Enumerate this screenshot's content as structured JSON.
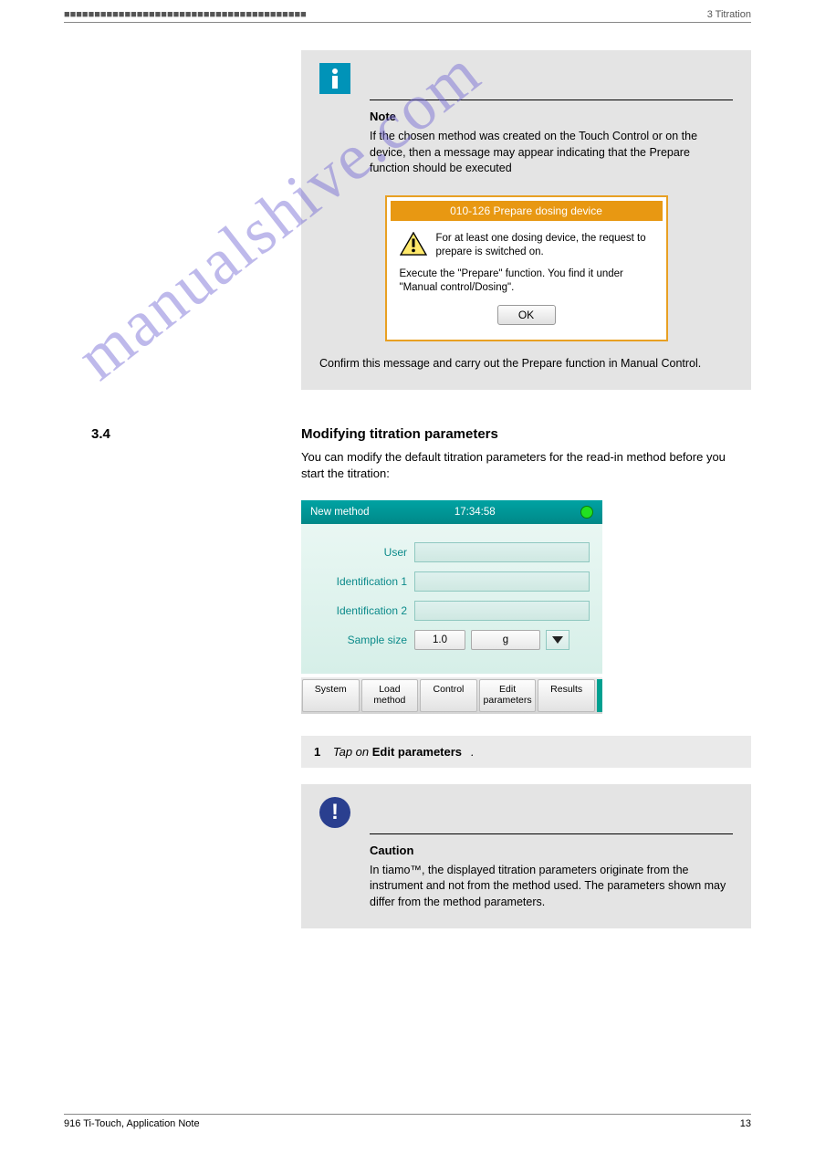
{
  "header": {
    "left": "■■■■■■■■■■■■■■■■■■■■■■■■■■■■■■■■■■■■■■■■",
    "right": "3 Titration"
  },
  "note1": {
    "heading": "Note",
    "body": "If the chosen method was created on the Touch Control or on the device, then a message may appear indicating that the Prepare function should be executed"
  },
  "dialog": {
    "title": "010-126 Prepare dosing device",
    "line1": "For at least one dosing device, the request to prepare is switched on.",
    "line2": "Execute the \"Prepare\" function. You find it under \"Manual control/Dosing\".",
    "ok": "OK"
  },
  "after_dialog": "Confirm this message and carry out the Prepare function in Manual Control.",
  "section": {
    "num": "3.4",
    "title": "Modifying titration parameters",
    "intro": "You can modify the default titration parameters for the read-in method before you start the titration:"
  },
  "device": {
    "title": "New method",
    "time": "17:34:58",
    "fields": {
      "user_label": "User",
      "id1_label": "Identification 1",
      "id2_label": "Identification 2",
      "sample_label": "Sample size",
      "sample_value": "1.0",
      "sample_unit": "g"
    },
    "tabs": [
      "System",
      "Load\nmethod",
      "Control",
      "Edit\nparameters",
      "Results"
    ]
  },
  "step": {
    "num": "1",
    "text": "Tap on Edit parameters."
  },
  "caution": {
    "heading": "Caution",
    "body": "In tiamo™, the displayed titration parameters originate from the instrument and not from the method used. The parameters shown may differ from the method parameters."
  },
  "footer": {
    "left": "916 Ti-Touch, Application Note",
    "right": "13"
  },
  "watermark": "manualshive.com"
}
